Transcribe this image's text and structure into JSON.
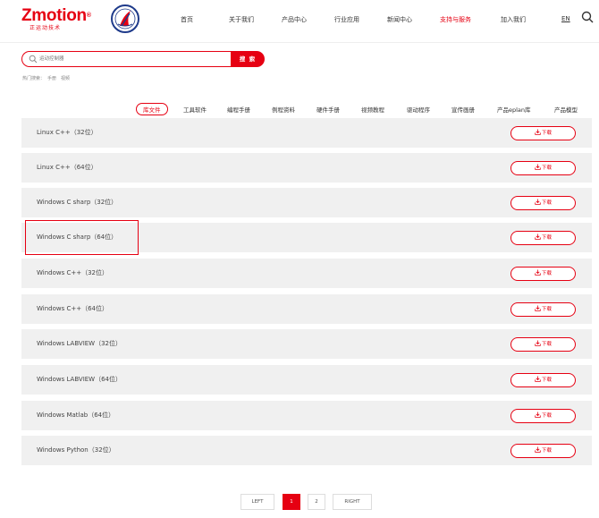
{
  "brand": {
    "name": "Zmotion",
    "trademark": "®",
    "subtitle": "正运动技术",
    "accent_color": "#e60012"
  },
  "nav": {
    "items": [
      {
        "label": "首页"
      },
      {
        "label": "关于我们"
      },
      {
        "label": "产品中心"
      },
      {
        "label": "行业应用"
      },
      {
        "label": "新闻中心"
      },
      {
        "label": "支持与服务",
        "active": true
      },
      {
        "label": "加入我们"
      }
    ],
    "lang": "EN",
    "search_icon": "search-icon"
  },
  "search": {
    "placeholder": "运动控制器",
    "button_label": "搜 索",
    "hot_label": "热门搜索：",
    "hot_items": [
      "手册",
      "视频"
    ]
  },
  "tabs": [
    {
      "label": "库文件",
      "active": true
    },
    {
      "label": "工具软件"
    },
    {
      "label": "编程手册"
    },
    {
      "label": "例程资料"
    },
    {
      "label": "硬件手册"
    },
    {
      "label": "视频教程"
    },
    {
      "label": "驱动程序"
    },
    {
      "label": "宣传画册"
    },
    {
      "label": "产品eplan库"
    },
    {
      "label": "产品模型"
    }
  ],
  "files": [
    {
      "name": "Linux C++（32位）",
      "download_label": "下载"
    },
    {
      "name": "Linux C++（64位）",
      "download_label": "下载"
    },
    {
      "name": "Windows C sharp（32位）",
      "download_label": "下载"
    },
    {
      "name": "Windows C sharp（64位）",
      "download_label": "下载"
    },
    {
      "name": "Windows C++（32位）",
      "download_label": "下载"
    },
    {
      "name": "Windows C++（64位）",
      "download_label": "下载"
    },
    {
      "name": "Windows LABVIEW（32位）",
      "download_label": "下载"
    },
    {
      "name": "Windows LABVIEW（64位）",
      "download_label": "下载"
    },
    {
      "name": "Windows Matlab（64位）",
      "download_label": "下载"
    },
    {
      "name": "Windows Python（32位）",
      "download_label": "下载"
    }
  ],
  "pagination": {
    "prev": "LEFT",
    "pages": [
      "1",
      "2"
    ],
    "current": "1",
    "next": "RIGHT"
  }
}
